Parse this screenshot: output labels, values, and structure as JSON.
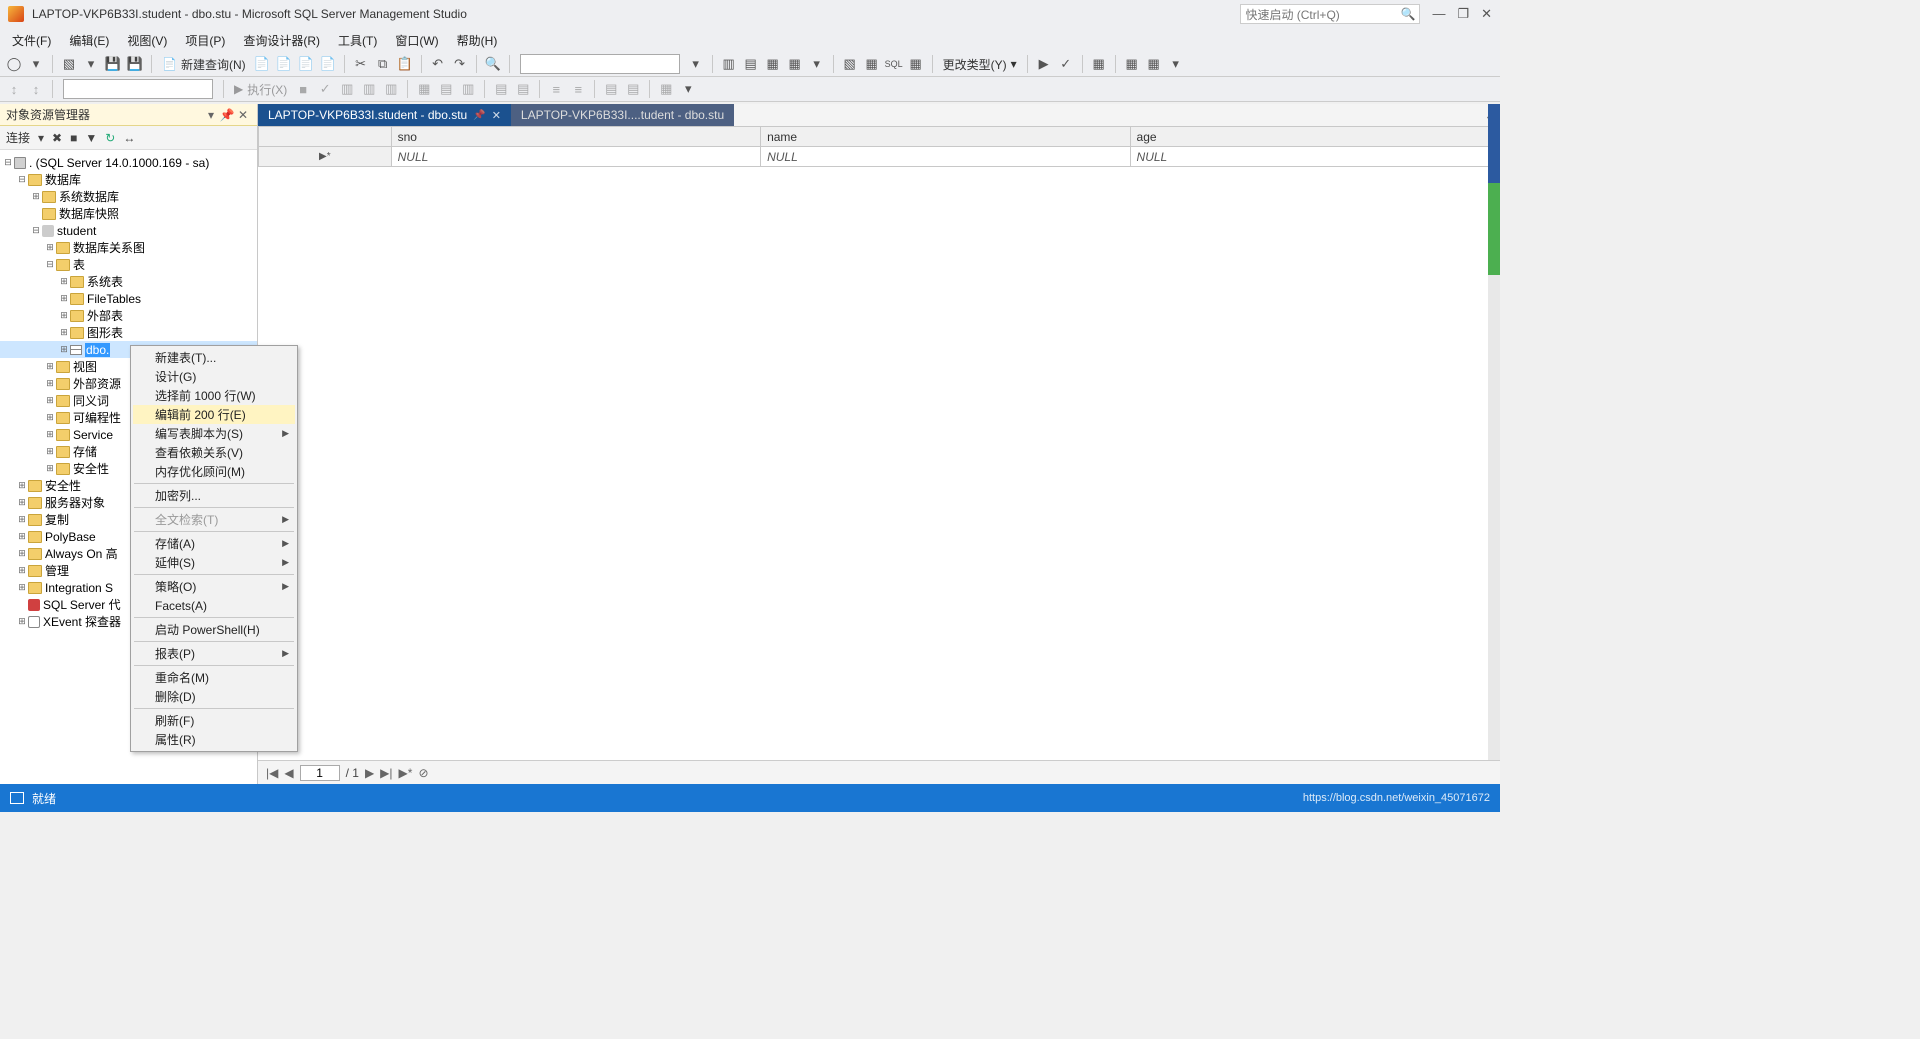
{
  "title": "LAPTOP-VKP6B33I.student - dbo.stu - Microsoft SQL Server Management Studio",
  "quick_launch_placeholder": "快速启动 (Ctrl+Q)",
  "menubar": [
    "文件(F)",
    "编辑(E)",
    "视图(V)",
    "项目(P)",
    "查询设计器(R)",
    "工具(T)",
    "窗口(W)",
    "帮助(H)"
  ],
  "toolbar1": {
    "new_query": "新建查询(N)",
    "change_type": "更改类型(Y)"
  },
  "toolbar2": {
    "execute": "执行(X)"
  },
  "object_explorer": {
    "title": "对象资源管理器",
    "connect_label": "连接",
    "root": ". (SQL Server 14.0.1000.169 - sa)",
    "nodes": {
      "databases": "数据库",
      "sys_databases": "系统数据库",
      "db_snapshots": "数据库快照",
      "student": "student",
      "db_diagrams": "数据库关系图",
      "tables": "表",
      "sys_tables": "系统表",
      "file_tables": "FileTables",
      "external_tables": "外部表",
      "graph_tables": "图形表",
      "dbo_stu": "dbo.",
      "views": "视图",
      "ext_resources": "外部资源",
      "synonyms": "同义词",
      "programmability": "可编程性",
      "service": "Service",
      "storage": "存储",
      "security_db": "安全性",
      "security_srv": "安全性",
      "server_objects": "服务器对象",
      "replication": "复制",
      "polybase": "PolyBase",
      "always_on": "Always On 高",
      "management": "管理",
      "integration": "Integration S",
      "sql_agent": "SQL Server 代",
      "xevent": "XEvent 探查器"
    }
  },
  "context_menu": {
    "new_table": "新建表(T)...",
    "design": "设计(G)",
    "select_top": "选择前 1000 行(W)",
    "edit_top": "编辑前 200 行(E)",
    "script_table": "编写表脚本为(S)",
    "view_deps": "查看依赖关系(V)",
    "mem_opt": "内存优化顾问(M)",
    "encrypt": "加密列...",
    "fulltext": "全文检索(T)",
    "storage": "存储(A)",
    "stretch": "延伸(S)",
    "policies": "策略(O)",
    "facets": "Facets(A)",
    "powershell": "启动 PowerShell(H)",
    "reports": "报表(P)",
    "rename": "重命名(M)",
    "delete": "删除(D)",
    "refresh": "刷新(F)",
    "properties": "属性(R)"
  },
  "tabs": [
    {
      "label": "LAPTOP-VKP6B33I.student - dbo.stu",
      "active": true
    },
    {
      "label": "LAPTOP-VKP6B33I....tudent - dbo.stu",
      "active": false
    }
  ],
  "grid": {
    "columns": [
      "sno",
      "name",
      "age"
    ],
    "null_text": "NULL",
    "row_marker": "▶*"
  },
  "gridnav": {
    "pos": "1",
    "of": "/ 1"
  },
  "statusbar": {
    "ready": "就绪",
    "url": "https://blog.csdn.net/weixin_45071672"
  }
}
